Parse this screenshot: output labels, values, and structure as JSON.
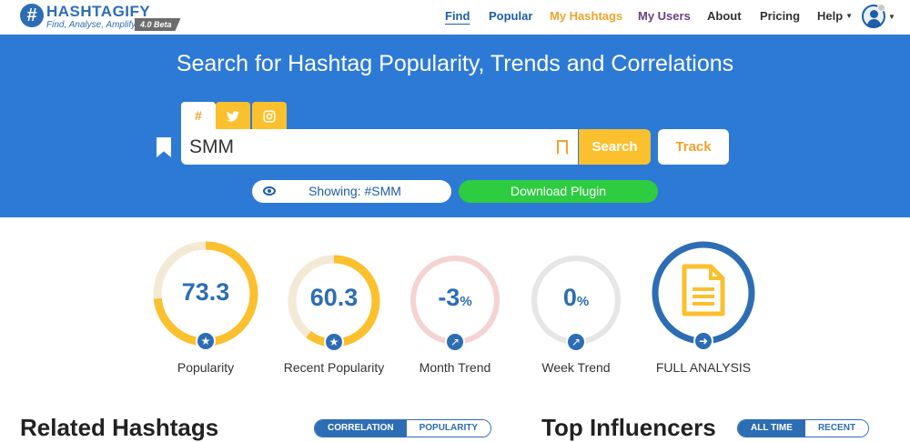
{
  "brand": {
    "logo_title": "HASHTAGIFY",
    "logo_subtitle": "Find, Analyse, Amplify",
    "version_badge": "4.0 Beta",
    "colors": {
      "primary": "#2d6db4",
      "hero": "#2d7ad6",
      "accent": "#fbc02d",
      "green": "#2ecc40"
    }
  },
  "nav": {
    "find": "Find",
    "popular": "Popular",
    "my_hashtags": "My Hashtags",
    "my_users": "My Users",
    "about": "About",
    "pricing": "Pricing",
    "help": "Help"
  },
  "hero": {
    "title": "Search for Hashtag Popularity, Trends and Correlations",
    "tabs": [
      {
        "icon": "hashtag-icon",
        "glyph": "#"
      },
      {
        "icon": "twitter-icon",
        "glyph": "🐦"
      },
      {
        "icon": "instagram-icon",
        "glyph": "◙"
      }
    ],
    "search_value": "SMM",
    "search_button": "Search",
    "track_button": "Track",
    "showing_label": "Showing: #SMM",
    "plugin_button": "Download Plugin"
  },
  "metrics": [
    {
      "value": "73.3",
      "label": "Popularity",
      "fraction": 0.733,
      "color": "#fbc02d",
      "track": "#f3ead6",
      "badge_icon": "star-icon"
    },
    {
      "value": "60.3",
      "label": "Recent Popularity",
      "fraction": 0.603,
      "color": "#fbc02d",
      "track": "#f3ead6",
      "badge_icon": "star-icon"
    },
    {
      "value": "-3",
      "unit": "%",
      "label": "Month Trend",
      "fraction": 1.0,
      "color": "#f5d3d3",
      "track": "#f5d3d3",
      "badge_icon": "trend-icon"
    },
    {
      "value": "0",
      "unit": "%",
      "label": "Week Trend",
      "fraction": 1.0,
      "color": "#e6e6e6",
      "track": "#e6e6e6",
      "badge_icon": "trend-icon"
    }
  ],
  "full_analysis": {
    "label": "FULL ANALYSIS",
    "icon": "document-icon",
    "ring_color": "#2d6db4"
  },
  "sections": {
    "related_title": "Related Hashtags",
    "related_toggle": [
      "CORRELATION",
      "POPULARITY"
    ],
    "influencers_title": "Top Influencers",
    "influencers_toggle": [
      "ALL TIME",
      "RECENT"
    ]
  }
}
